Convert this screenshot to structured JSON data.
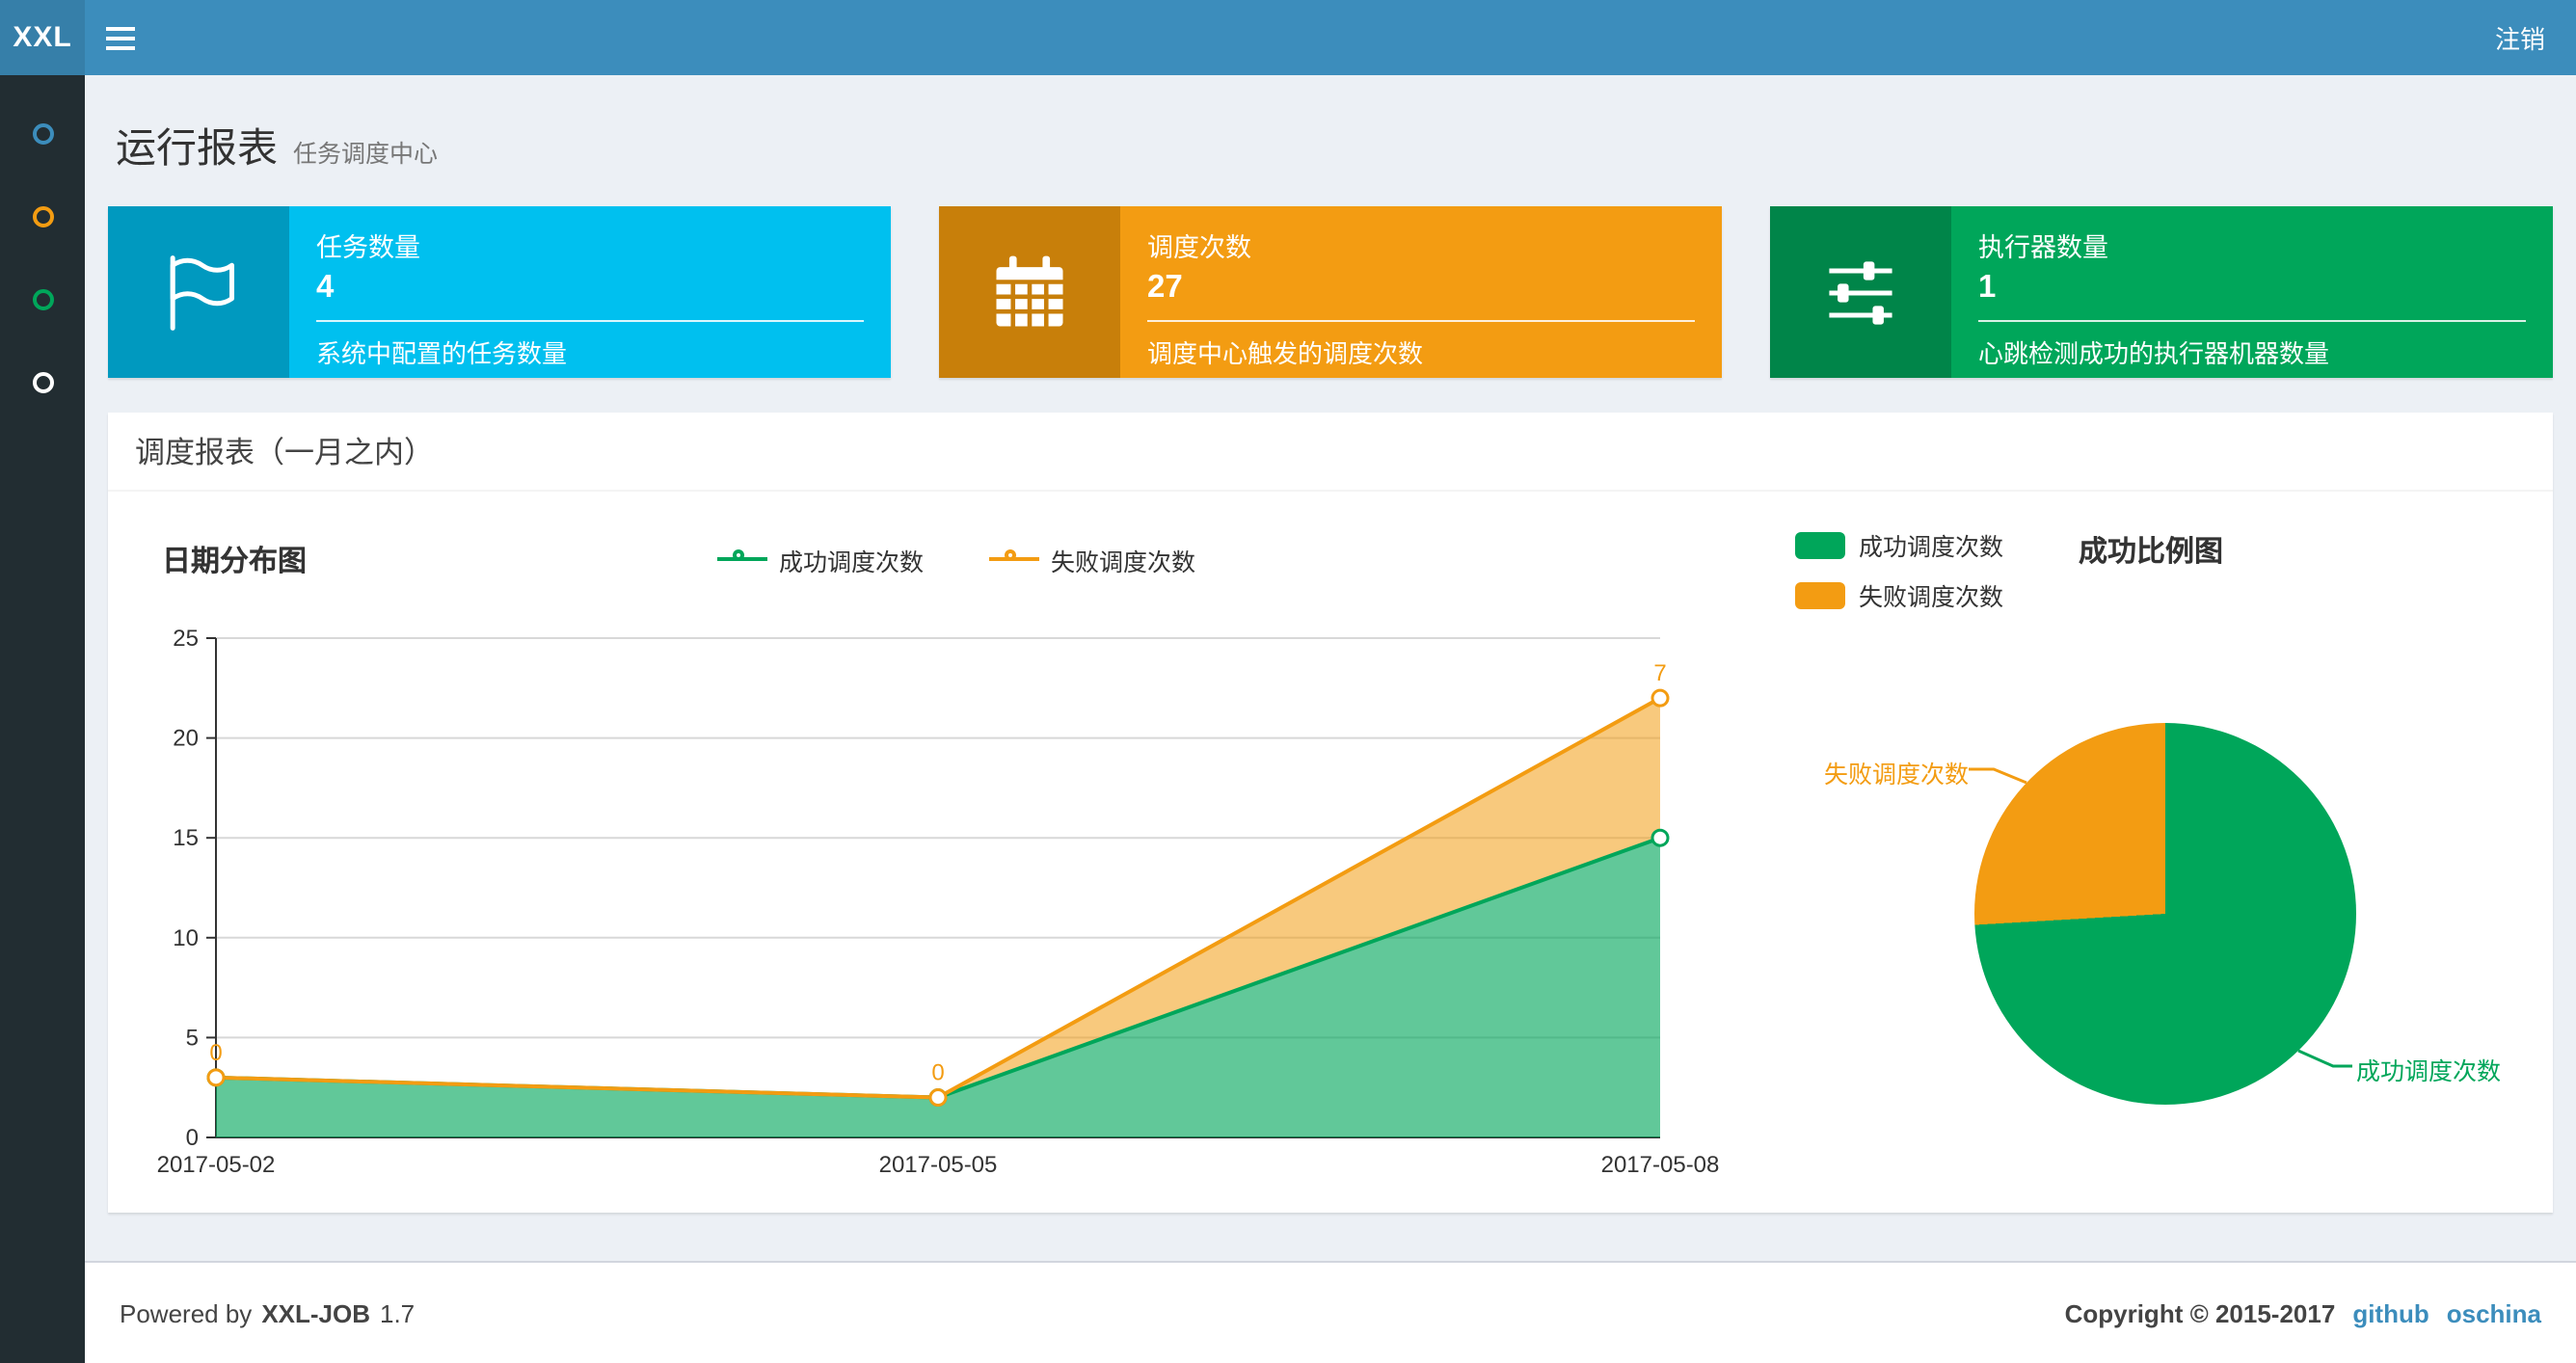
{
  "theme": {
    "navbar_bg": "#3c8dbc",
    "logo_bg": "#367fa9",
    "sidebar_bg": "#222d32",
    "content_bg": "#ecf0f5",
    "link_color": "#3c8dbc"
  },
  "navbar": {
    "logo": "XXL",
    "logout": "注销"
  },
  "sidebar": {
    "items": [
      {
        "icon": "circle-icon",
        "color": "#3c8dbc"
      },
      {
        "icon": "circle-icon",
        "color": "#f39c12"
      },
      {
        "icon": "circle-icon",
        "color": "#00a65a"
      },
      {
        "icon": "circle-icon",
        "color": "#ffffff"
      }
    ]
  },
  "page_header": {
    "title": "运行报表",
    "subtitle": "任务调度中心"
  },
  "info_boxes": [
    {
      "label": "任务数量",
      "value": "4",
      "desc": "系统中配置的任务数量",
      "bg": "#00c0ef",
      "icon_bg": "#0099bf",
      "icon": "flag-icon"
    },
    {
      "label": "调度次数",
      "value": "27",
      "desc": "调度中心触发的调度次数",
      "bg": "#f39c12",
      "icon_bg": "#c87f0a",
      "icon": "calendar-icon"
    },
    {
      "label": "执行器数量",
      "value": "1",
      "desc": "心跳检测成功的执行器机器数量",
      "bg": "#00a65a",
      "icon_bg": "#008549",
      "icon": "sliders-icon"
    }
  ],
  "panel": {
    "title": "调度报表（一月之内）"
  },
  "chart_data": [
    {
      "type": "area",
      "title": "日期分布图",
      "categories": [
        "2017-05-02",
        "2017-05-05",
        "2017-05-08"
      ],
      "series": [
        {
          "name": "成功调度次数",
          "values": [
            3,
            2,
            15
          ],
          "color": "#00a65a"
        },
        {
          "name": "失败调度次数",
          "values": [
            0,
            0,
            7
          ],
          "color": "#f39c12"
        }
      ],
      "stacked": true,
      "ylim": [
        0,
        25
      ],
      "y_ticks": [
        0,
        5,
        10,
        15,
        20,
        25
      ],
      "grid": true,
      "legend_position": "top-center",
      "data_labels_series": "失败调度次数"
    },
    {
      "type": "pie",
      "title": "成功比例图",
      "slices": [
        {
          "name": "成功调度次数",
          "value": 20,
          "color": "#00a65a"
        },
        {
          "name": "失败调度次数",
          "value": 7,
          "color": "#f39c12"
        }
      ],
      "legend_position": "top-left"
    }
  ],
  "footer": {
    "powered_by": "Powered by",
    "product": "XXL-JOB",
    "version": "1.7",
    "copyright": "Copyright © 2015-2017",
    "links": [
      {
        "label": "github"
      },
      {
        "label": "oschina"
      }
    ]
  }
}
